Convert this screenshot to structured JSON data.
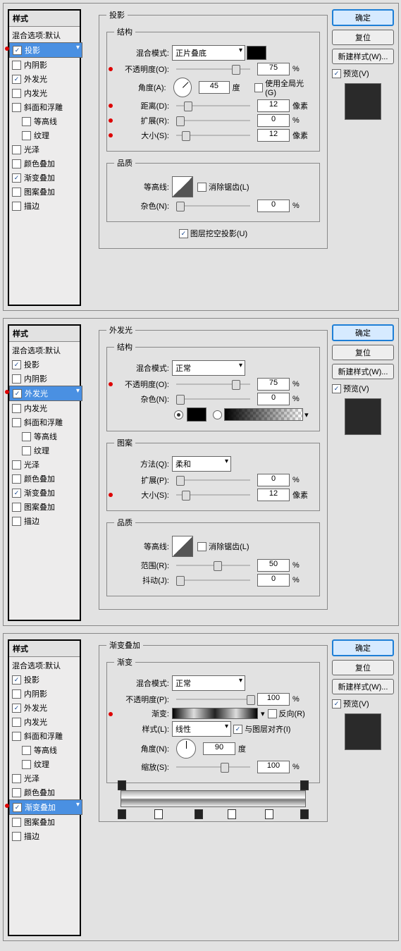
{
  "common": {
    "ok": "确定",
    "reset": "复位",
    "newStyle": "新建样式(W)...",
    "preview": "预览(V)",
    "stylesHeader": "样式",
    "blendDefault": "混合选项:默认",
    "styleNames": [
      "投影",
      "内阴影",
      "外发光",
      "内发光",
      "斜面和浮雕",
      "等高线",
      "纹理",
      "光泽",
      "颜色叠加",
      "渐变叠加",
      "图案叠加",
      "描边"
    ]
  },
  "p1": {
    "selected": 0,
    "checked": [
      true,
      false,
      true,
      false,
      false,
      false,
      false,
      false,
      false,
      true,
      false,
      false
    ],
    "title": "投影",
    "structure": {
      "legend": "结构",
      "mode": "混合模式:",
      "modeVal": "正片叠底",
      "swatch": "#000000",
      "opacity": "不透明度(O):",
      "opacityVal": "75",
      "opacityUnit": "%",
      "angle": "角度(A):",
      "angleVal": "45",
      "angleUnit": "度",
      "useGlobal": "使用全局光(G)",
      "distance": "距离(D):",
      "distanceVal": "12",
      "distanceUnit": "像素",
      "spread": "扩展(R):",
      "spreadVal": "0",
      "spreadUnit": "%",
      "size": "大小(S):",
      "sizeVal": "12",
      "sizeUnit": "像素"
    },
    "quality": {
      "legend": "品质",
      "contour": "等高线:",
      "antiAlias": "消除锯齿(L)",
      "noise": "杂色(N):",
      "noiseVal": "0",
      "noiseUnit": "%"
    },
    "knockout": "图层挖空投影(U)"
  },
  "p2": {
    "selected": 2,
    "checked": [
      true,
      false,
      true,
      false,
      false,
      false,
      false,
      false,
      false,
      true,
      false,
      false
    ],
    "title": "外发光",
    "structure": {
      "legend": "结构",
      "mode": "混合模式:",
      "modeVal": "正常",
      "opacity": "不透明度(O):",
      "opacityVal": "75",
      "opacityUnit": "%",
      "noise": "杂色(N):",
      "noiseVal": "0",
      "noiseUnit": "%",
      "swatch": "#000000"
    },
    "elements": {
      "legend": "图案",
      "method": "方法(Q):",
      "methodVal": "柔和",
      "spread": "扩展(P):",
      "spreadVal": "0",
      "spreadUnit": "%",
      "size": "大小(S):",
      "sizeVal": "12",
      "sizeUnit": "像素"
    },
    "quality": {
      "legend": "品质",
      "contour": "等高线:",
      "antiAlias": "消除锯齿(L)",
      "range": "范围(R):",
      "rangeVal": "50",
      "rangeUnit": "%",
      "jitter": "抖动(J):",
      "jitterVal": "0",
      "jitterUnit": "%"
    }
  },
  "p3": {
    "selected": 9,
    "checked": [
      true,
      false,
      true,
      false,
      false,
      false,
      false,
      false,
      false,
      true,
      false,
      false
    ],
    "title": "渐变叠加",
    "gradient": {
      "legend": "渐变",
      "mode": "混合模式:",
      "modeVal": "正常",
      "opacity": "不透明度(P):",
      "opacityVal": "100",
      "opacityUnit": "%",
      "grad": "渐变:",
      "reverse": "反向(R)",
      "style": "样式(L):",
      "styleVal": "线性",
      "align": "与图层对齐(I)",
      "angle": "角度(N):",
      "angleVal": "90",
      "angleUnit": "度",
      "scale": "缩放(S):",
      "scaleVal": "100",
      "scaleUnit": "%"
    }
  },
  "chart_data": null
}
